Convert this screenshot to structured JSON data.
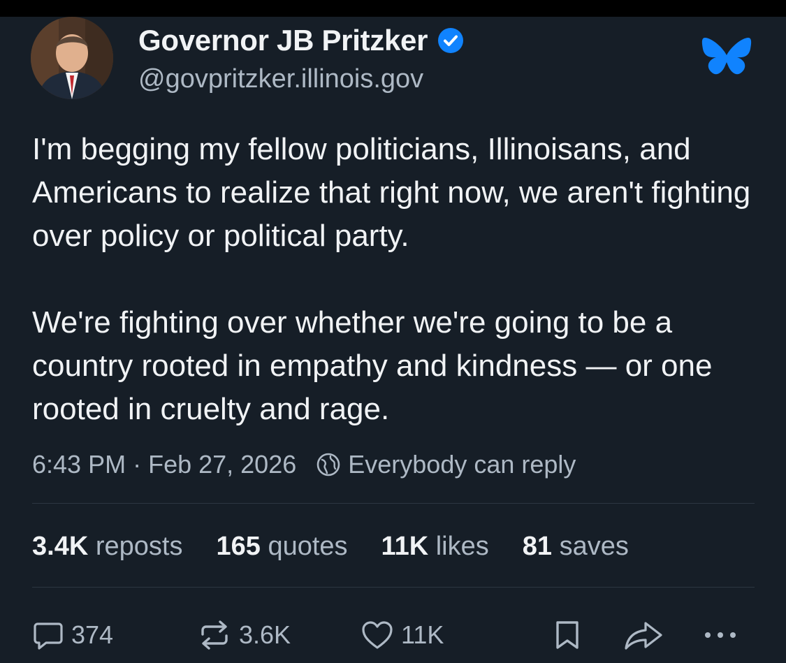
{
  "post": {
    "author": {
      "display_name": "Governor JB Pritzker",
      "handle": "@govpritzker.illinois.gov",
      "verified": true
    },
    "paragraphs": [
      "I'm begging my fellow politicians, Illinoisans, and Americans to realize that right now, we aren't fighting over policy or political party.",
      "We're fighting over whether we're going to be a country rooted in empathy and kindness — or one rooted in cruelty and rage."
    ],
    "time": "6:43 PM",
    "separator": "·",
    "date": "Feb 27, 2026",
    "reply_setting": "Everybody can reply",
    "stats": [
      {
        "value": "3.4K",
        "label": "reposts"
      },
      {
        "value": "165",
        "label": "quotes"
      },
      {
        "value": "11K",
        "label": "likes"
      },
      {
        "value": "81",
        "label": "saves"
      }
    ],
    "actions": {
      "reply_count": "374",
      "repost_count": "3.6K",
      "like_count": "11K"
    }
  },
  "icons": {
    "verified": "verified-badge-icon",
    "app_logo": "bluesky-butterfly-icon",
    "reply_setting": "globe-icon",
    "reply": "speech-bubble-icon",
    "repost": "repost-arrows-icon",
    "like": "heart-icon",
    "bookmark": "bookmark-icon",
    "share": "share-arrow-icon",
    "more": "ellipsis-icon"
  },
  "colors": {
    "background": "#161e27",
    "text_primary": "#f1f3f5",
    "text_secondary": "#aeb9c5",
    "accent": "#1083fe",
    "divider": "#2c3642"
  }
}
